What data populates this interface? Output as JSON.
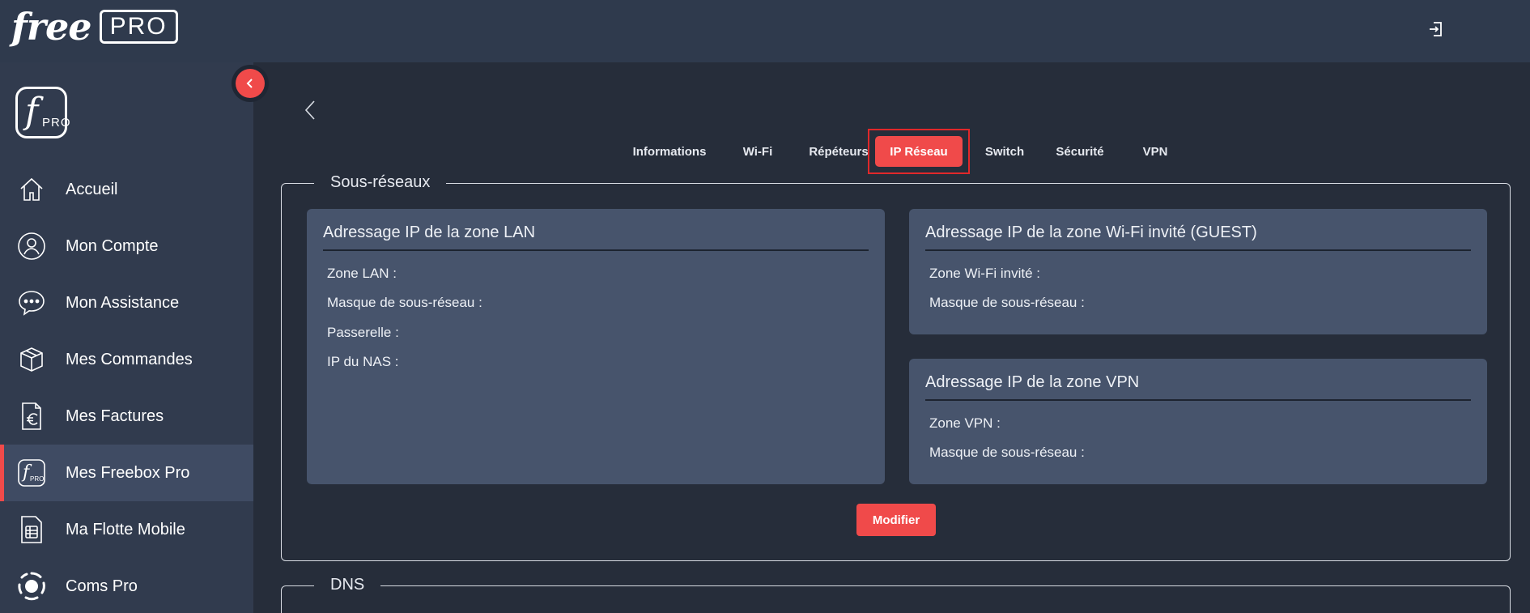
{
  "header": {
    "brand_free": "free",
    "brand_pro": "PRO"
  },
  "sidebar": {
    "logo_f": "f",
    "logo_pro": "PRO",
    "items": [
      {
        "label": "Accueil",
        "icon": "home-icon"
      },
      {
        "label": "Mon Compte",
        "icon": "user-icon"
      },
      {
        "label": "Mon Assistance",
        "icon": "chat-icon"
      },
      {
        "label": "Mes Commandes",
        "icon": "box-icon"
      },
      {
        "label": "Mes Factures",
        "icon": "invoice-euro-icon"
      },
      {
        "label": "Mes Freebox Pro",
        "icon": "freebox-pro-icon",
        "active": true
      },
      {
        "label": "Ma Flotte Mobile",
        "icon": "sim-card-icon"
      },
      {
        "label": "Coms Pro",
        "icon": "coms-pro-icon"
      }
    ]
  },
  "tabs": [
    {
      "label": "Informations"
    },
    {
      "label": "Wi-Fi"
    },
    {
      "label": "Répéteurs"
    },
    {
      "label": "IP Réseau",
      "active": true
    },
    {
      "label": "Switch"
    },
    {
      "label": "Sécurité"
    },
    {
      "label": "VPN"
    }
  ],
  "subnets": {
    "legend": "Sous-réseaux",
    "lan": {
      "title": "Adressage IP de la zone LAN",
      "rows": [
        "Zone LAN :",
        "Masque de sous-réseau :",
        "Passerelle :",
        "IP du NAS :"
      ]
    },
    "guest": {
      "title": "Adressage IP de la zone Wi-Fi invité (GUEST)",
      "rows": [
        "Zone Wi-Fi invité :",
        "Masque de sous-réseau :"
      ]
    },
    "vpn": {
      "title": "Adressage IP de la zone VPN",
      "rows": [
        "Zone VPN :",
        "Masque de sous-réseau :"
      ]
    },
    "modify_label": "Modifier"
  },
  "dns": {
    "legend": "DNS"
  },
  "colors": {
    "accent": "#f04a4a",
    "header_bg": "#2f3a4d",
    "sidebar_bg": "#313b4e",
    "content_bg": "#262d3a",
    "card_bg": "#47546c"
  }
}
